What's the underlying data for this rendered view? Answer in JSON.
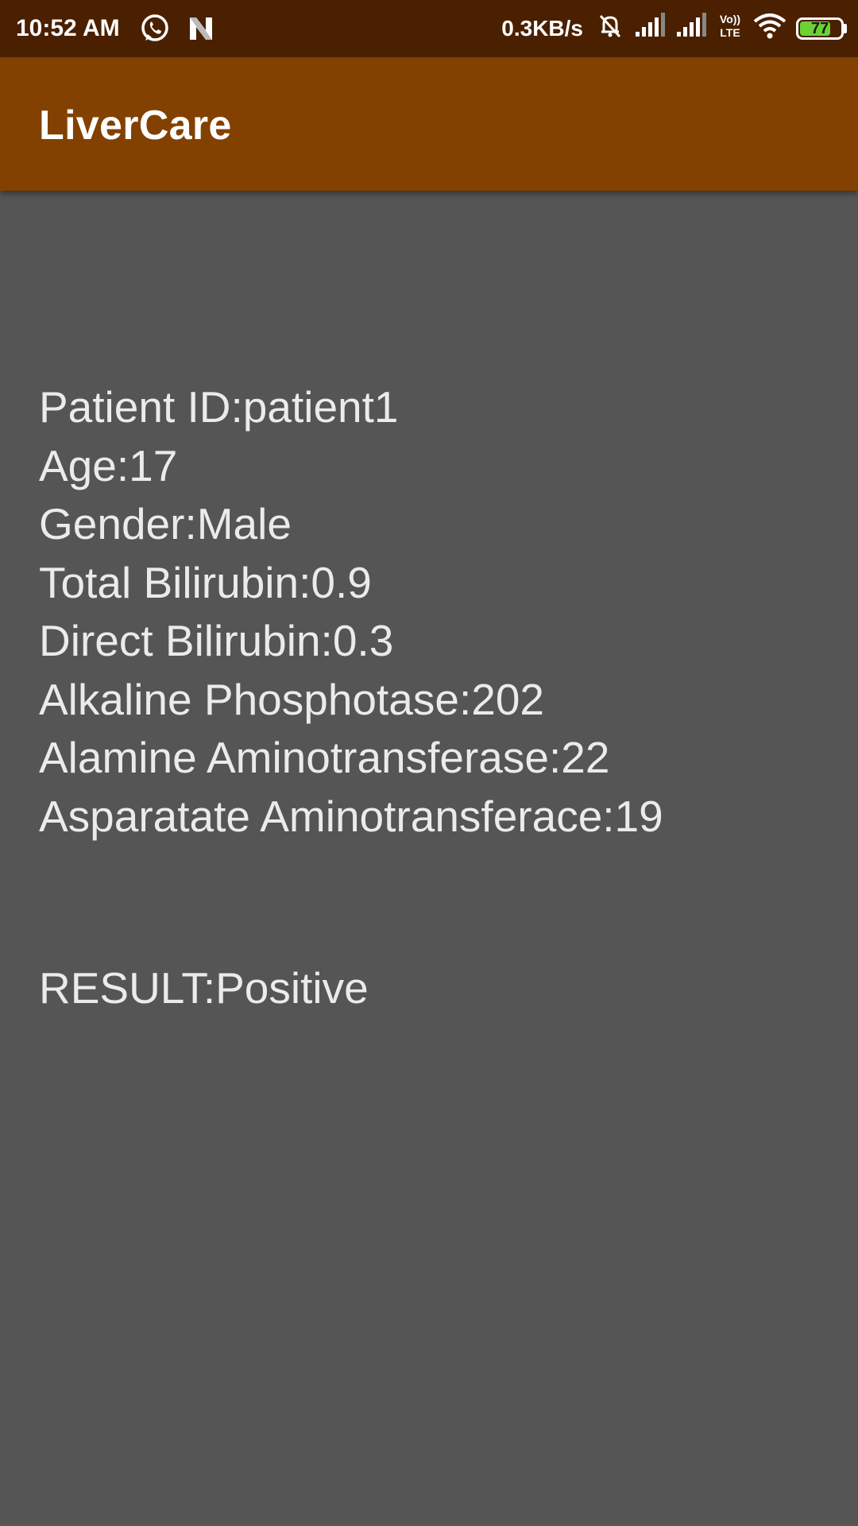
{
  "status_bar": {
    "time": "10:52 AM",
    "net_speed": "0.3KB/s",
    "volte_label_top": "Vo))",
    "volte_label_bottom": "LTE",
    "battery_level": "77",
    "battery_fraction": 0.77,
    "icons": [
      "whatsapp-icon",
      "n-app-icon",
      "mute-bell-icon",
      "signal-icon",
      "signal-icon",
      "volte-icon",
      "wifi-icon",
      "battery-icon"
    ],
    "colors": {
      "background": "#4a2000",
      "battery_fill": "#6cd233"
    }
  },
  "app_bar": {
    "title": "LiverCare",
    "color": "#824100"
  },
  "patient": {
    "patient_id": "Patient ID:patient1",
    "age": "Age:17",
    "gender": "Gender:Male",
    "total_bilirubin": "Total Bilirubin:0.9",
    "direct_bilirubin": "Direct Bilirubin:0.3",
    "alkaline_phosphotase": "Alkaline Phosphotase:202",
    "alamine_aminotransferase": "Alamine Aminotransferase:22",
    "asparatate_aminotransferace": "Asparatate Aminotransferace:19"
  },
  "result": "RESULT:Positive",
  "colors": {
    "page_background": "#555555",
    "text": "#ebebeb"
  }
}
